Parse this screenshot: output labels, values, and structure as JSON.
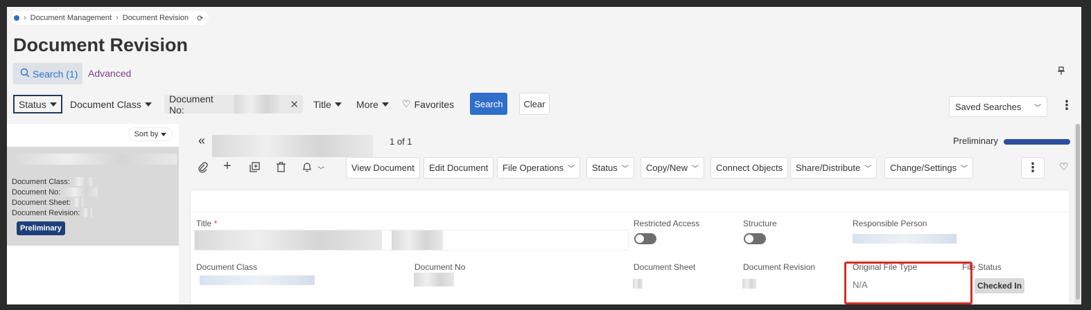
{
  "breadcrumb": {
    "items": [
      "Document Management",
      "Document Revision"
    ],
    "refresh_icon": "refresh-icon"
  },
  "page": {
    "title": "Document Revision"
  },
  "tabs": {
    "search": "Search (1)",
    "advanced": "Advanced"
  },
  "filters": {
    "status": "Status",
    "document_class": "Document Class",
    "document_no_label": "Document No:",
    "title": "Title",
    "more": "More",
    "favorites": "Favorites",
    "search_button": "Search",
    "clear_button": "Clear",
    "saved_searches": "Saved Searches"
  },
  "list": {
    "sort_by": "Sort by",
    "card": {
      "document_class_label": "Document Class:",
      "document_no_label": "Document No:",
      "document_sheet_label": "Document Sheet:",
      "document_revision_label": "Document Revision:",
      "badge": "Preliminary"
    }
  },
  "record": {
    "position": "1 of 1",
    "state": "Preliminary",
    "state_progress": 1.0
  },
  "toolbar": {
    "view_document": "View Document",
    "edit_document": "Edit Document",
    "file_operations": "File Operations",
    "status": "Status",
    "copy_new": "Copy/New",
    "connect_objects": "Connect Objects",
    "share_distribute": "Share/Distribute",
    "change_settings": "Change/Settings"
  },
  "form": {
    "title_label": "Title",
    "required_mark": "*",
    "restricted_access_label": "Restricted Access",
    "structure_label": "Structure",
    "responsible_person_label": "Responsible Person",
    "document_class_label": "Document Class",
    "document_no_label": "Document No",
    "document_sheet_label": "Document Sheet",
    "document_revision_label": "Document Revision",
    "original_file_type_label": "Original File Type",
    "original_file_type_value": "N/A",
    "file_status_label": "File Status",
    "file_status_value": "Checked In"
  },
  "colors": {
    "accent": "#2f6fca",
    "advanced_link": "#7b3f88",
    "badge": "#1f3f7a",
    "highlight": "#d62b25"
  }
}
